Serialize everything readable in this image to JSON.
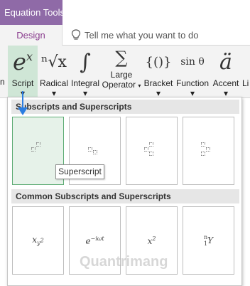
{
  "title_bar": {
    "tool_title": "Equation Tools"
  },
  "tabs": {
    "design": "Design",
    "tell_me": "Tell me what you want to do"
  },
  "ribbon": {
    "edge_label": "n",
    "buttons": [
      {
        "label": "Script",
        "glyph": "e",
        "glyph_sup": "x"
      },
      {
        "label": "Radical",
        "glyph": "ⁿ√x"
      },
      {
        "label": "Integral",
        "glyph": "∫"
      },
      {
        "label": "Large",
        "label2": "Operator",
        "glyph": "∑"
      },
      {
        "label": "Bracket",
        "glyph": "{()}"
      },
      {
        "label": "Function",
        "glyph": "sin θ"
      },
      {
        "label": "Accent",
        "glyph": "ä"
      },
      {
        "label": "Li",
        "glyph": ""
      }
    ],
    "dropdown_arrow": "▾"
  },
  "panel": {
    "section1": "Subscripts and Superscripts",
    "section2": "Common Subscripts and Superscripts",
    "tooltip": "Superscript"
  },
  "formulas": {
    "f1_base": "x",
    "f1_sub": "y",
    "f1_subsup": "2",
    "f2_base": "e",
    "f2_sup": "−iωt",
    "f3_base": "x",
    "f3_sup": "2",
    "f4_presup": "n",
    "f4_presub": "1",
    "f4_base": "Y"
  },
  "watermark": "Quantrimang",
  "colors": {
    "accent": "#8f6aa7",
    "tab_text": "#8b3f8f",
    "selected": "#cfe6d6",
    "hover": "#e6f2e9",
    "arrow": "#2a7de1"
  }
}
